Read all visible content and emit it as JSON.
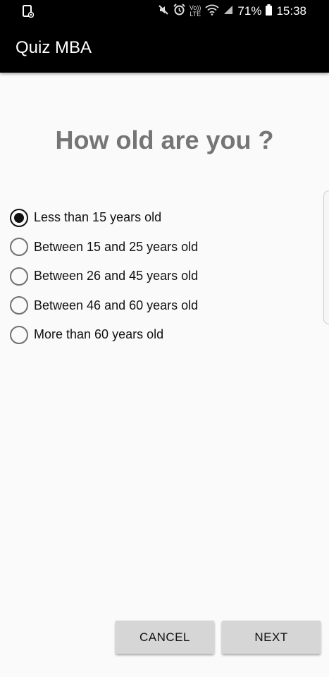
{
  "status_bar": {
    "battery_percent": "71%",
    "time": "15:38",
    "volte_top": "Vo))",
    "volte_bottom": "LTE",
    "icons": [
      "notification-icon",
      "mute-icon",
      "alarm-icon",
      "volte-icon",
      "wifi-icon",
      "signal-icon",
      "battery-icon"
    ]
  },
  "app_bar": {
    "title": "Quiz MBA"
  },
  "question": "How old are you ?",
  "options": [
    {
      "label": "Less than 15 years old",
      "selected": true
    },
    {
      "label": "Between 15 and 25 years old",
      "selected": false
    },
    {
      "label": "Between 26 and 45 years old",
      "selected": false
    },
    {
      "label": "Between 46 and 60 years old",
      "selected": false
    },
    {
      "label": "More than 60 years old",
      "selected": false
    }
  ],
  "buttons": {
    "cancel": "CANCEL",
    "next": "NEXT"
  },
  "colors": {
    "app_bar": "#000000",
    "background": "#fafafa",
    "question": "#757575",
    "button": "#d6d6d6"
  }
}
